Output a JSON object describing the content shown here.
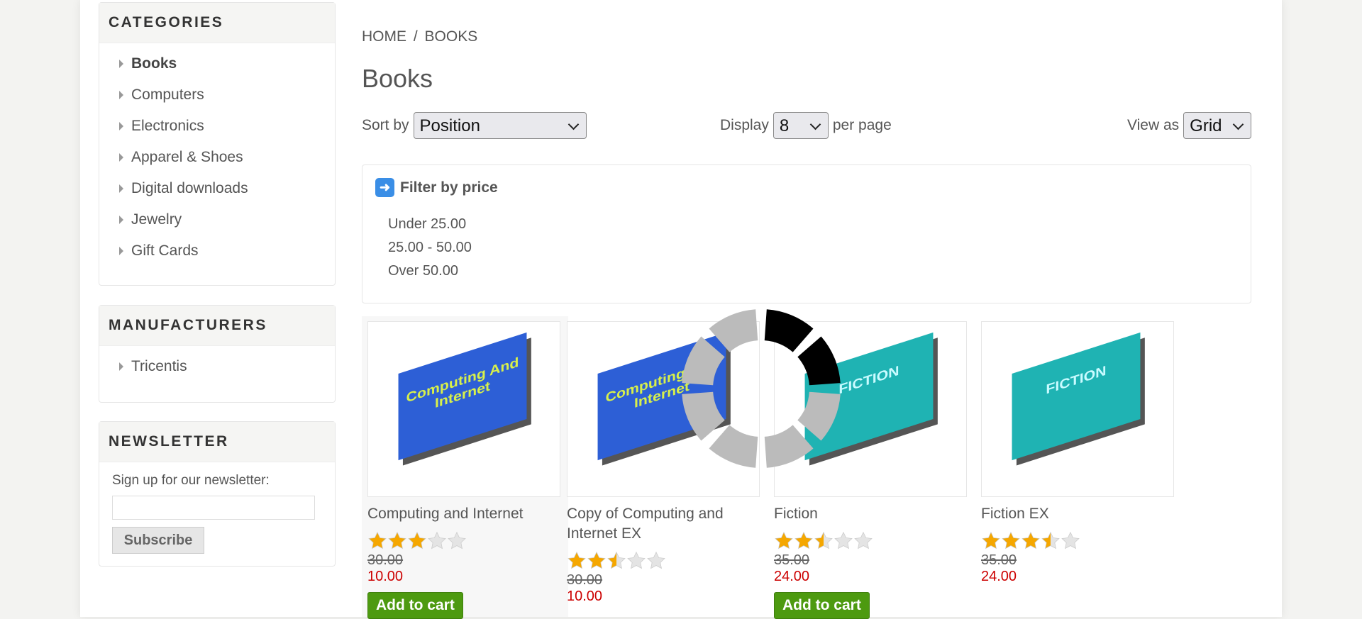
{
  "categories": {
    "title": "CATEGORIES",
    "items": [
      "Books",
      "Computers",
      "Electronics",
      "Apparel & Shoes",
      "Digital downloads",
      "Jewelry",
      "Gift Cards"
    ]
  },
  "manufacturers": {
    "title": "MANUFACTURERS",
    "items": [
      "Tricentis"
    ]
  },
  "newsletter": {
    "title": "NEWSLETTER",
    "label": "Sign up for our newsletter:",
    "button": "Subscribe"
  },
  "breadcrumb": {
    "home": "HOME",
    "sep": "/",
    "current": "BOOKS"
  },
  "page_title": "Books",
  "controls": {
    "sort_label": "Sort by",
    "sort_value": "Position",
    "display_label": "Display",
    "display_value": "8",
    "per_page": "per page",
    "view_label": "View as",
    "view_value": "Grid"
  },
  "filter": {
    "title": "Filter by price",
    "options": [
      "Under 25.00",
      "25.00 - 50.00",
      "Over 50.00"
    ]
  },
  "products": [
    {
      "name": "Computing and Internet",
      "rating": 3,
      "old_price": "30.00",
      "new_price": "10.00",
      "cart": "Add to cart",
      "cover": "blue",
      "cover_text": "Computing And Internet"
    },
    {
      "name": "Copy of Computing and Internet EX",
      "rating": 2.5,
      "old_price": "30.00",
      "new_price": "10.00",
      "cart": "",
      "cover": "blue",
      "cover_text": "Computing And Internet"
    },
    {
      "name": "Fiction",
      "rating": 2.5,
      "old_price": "35.00",
      "new_price": "24.00",
      "cart": "Add to cart",
      "cover": "teal",
      "cover_text": "FICTION"
    },
    {
      "name": "Fiction EX",
      "rating": 3.5,
      "old_price": "35.00",
      "new_price": "24.00",
      "cart": "",
      "cover": "teal",
      "cover_text": "FICTION"
    }
  ],
  "colors": {
    "price_new": "#cc0000",
    "cart_button": "#4d9a10",
    "filter_icon": "#3a8ee6",
    "star": "#f5a700"
  }
}
